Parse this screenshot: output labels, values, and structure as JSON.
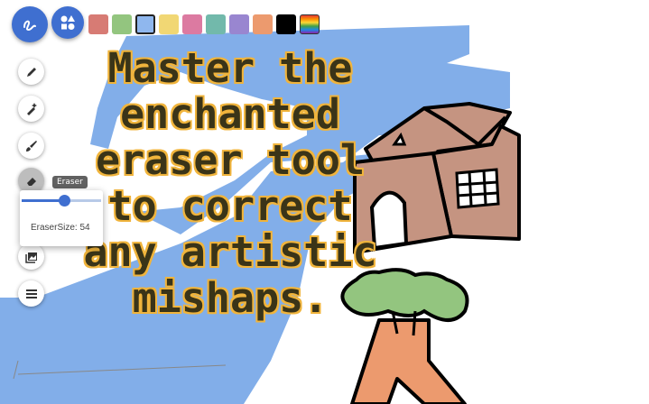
{
  "toolbar": {
    "palette": [
      {
        "name": "red",
        "color": "#d77b74"
      },
      {
        "name": "green",
        "color": "#93c57f"
      },
      {
        "name": "blue",
        "color": "#8fb7ee",
        "selected": true
      },
      {
        "name": "yellow",
        "color": "#f1d774"
      },
      {
        "name": "pink",
        "color": "#dc7aa1"
      },
      {
        "name": "teal",
        "color": "#72b9ab"
      },
      {
        "name": "purple",
        "color": "#9986d0"
      },
      {
        "name": "orange",
        "color": "#ec9a6e"
      },
      {
        "name": "black",
        "color": "#000000"
      },
      {
        "name": "rainbow",
        "color": "rainbow"
      }
    ]
  },
  "tools": [
    {
      "name": "pencil",
      "icon": "pencil-icon"
    },
    {
      "name": "magic-brush",
      "icon": "magic-brush-icon"
    },
    {
      "name": "brush",
      "icon": "brush-icon"
    },
    {
      "name": "eraser",
      "icon": "eraser-icon",
      "active": true
    },
    {
      "name": "image",
      "icon": "image-icon"
    },
    {
      "name": "menu",
      "icon": "menu-icon"
    }
  ],
  "eraser_popover": {
    "tooltip": "Eraser",
    "label": "EraserSize: 54",
    "size_fraction": 0.54
  },
  "caption": {
    "lines": [
      "Master the",
      "enchanted",
      "eraser tool",
      "to correct",
      "any artistic",
      "mishaps."
    ]
  },
  "colors": {
    "accent": "#3f6fd0",
    "stroke_blue": "#82aee9",
    "house_wall": "#c59481",
    "tree_leaves": "#93c57f",
    "tree_trunk": "#ec9a6e",
    "caption_fill": "#3a3418",
    "caption_outline": "#f0b43c"
  }
}
